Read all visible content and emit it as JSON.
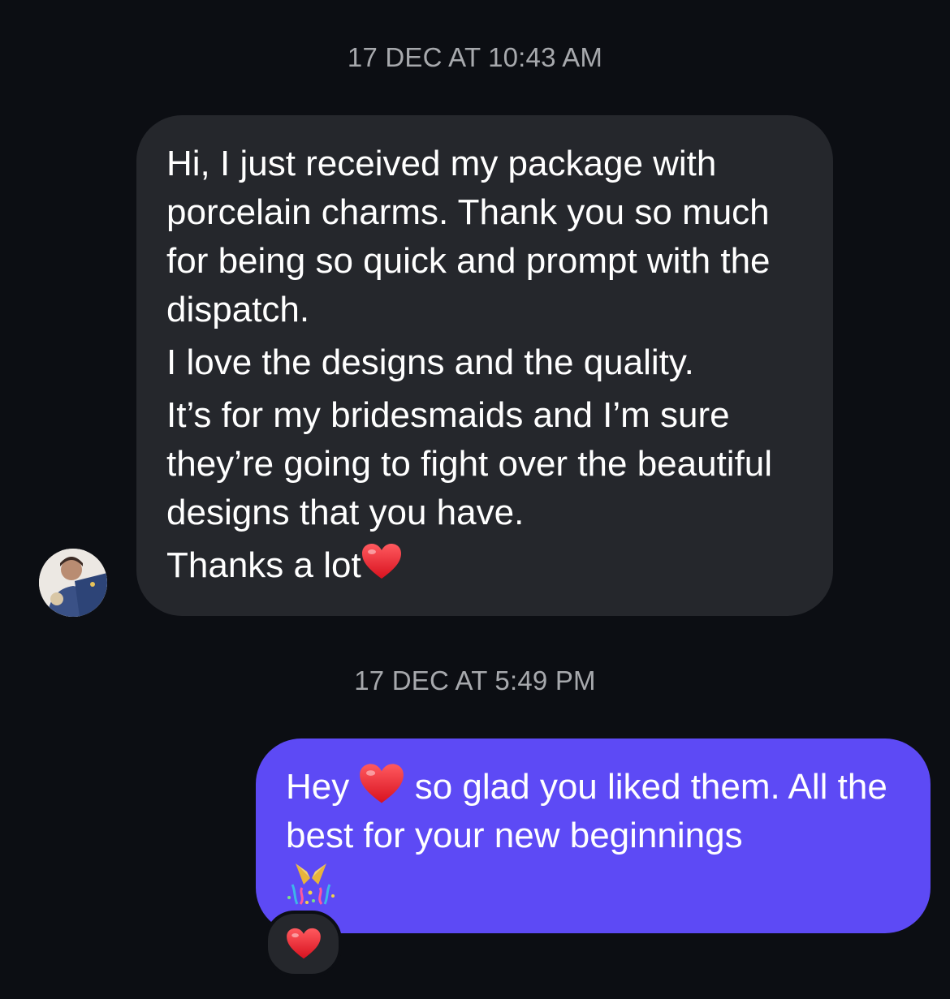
{
  "conversation": {
    "timestamps": [
      "17 DEC AT 10:43 AM",
      "17 DEC AT 5:49 PM"
    ],
    "incoming_message": {
      "paragraphs": [
        "Hi, I just received my package with porcelain charms. Thank you so much for being so quick and prompt with the dispatch.",
        "I love the designs and the quality.",
        "It’s for my bridesmaids and I’m sure they’re going to fight over the beautiful designs that you have.",
        "Thanks a lot"
      ],
      "trailing_emoji": "red-heart-icon"
    },
    "outgoing_message": {
      "part1": "Hey",
      "emoji1": "red-heart-icon",
      "part2": " so glad you liked them. All the best for your new beginnings",
      "emoji2": "party-popper-icon"
    },
    "reaction": "red-heart-icon"
  },
  "colors": {
    "background": "#0c0e13",
    "incoming_bubble": "#25272c",
    "outgoing_bubble": "#5d4af5",
    "timestamp_text": "#a7a9ad",
    "heart": "#e8202e"
  }
}
